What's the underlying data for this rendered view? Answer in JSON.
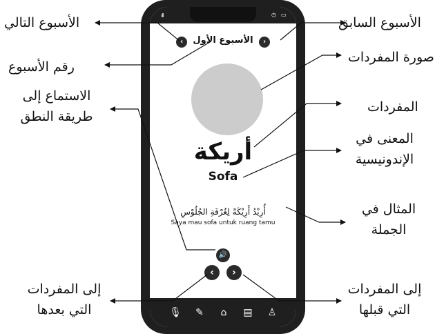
{
  "annotations": {
    "next_week": "الأسبوع التالي",
    "previous_week": "الأسبوع السابق",
    "week_number": "رقم الأسبوع",
    "vocab_picture": "صورة المفردات",
    "listen_line1": "الاستماع إلى",
    "listen_line2": "طريقة النطق",
    "vocabulary": "المفردات",
    "meaning_line1": "المعنى في",
    "meaning_line2": "الإندونيسية",
    "example_line1": "المثال في",
    "example_line2": "الجملة",
    "to_next_line1": "إلى المفردات",
    "to_next_line2": "التي بعدها",
    "to_prev_line1": "إلى المفردات",
    "to_prev_line2": "التي قبلها"
  },
  "phone": {
    "signal": "ıll",
    "week_title": "الأسبوع الأول",
    "prev_week_symbol": "‹",
    "next_week_symbol": "›",
    "vocab_word": "أريكة",
    "meaning": "Sofa",
    "example_arabic": "أُرِيْدُ أَرِيْكَةً لِغُرْفَةِ الجُلُوْسِ",
    "example_indonesian": "Saya mau sofa untuk ruang tamu",
    "speaker_symbol": "🔊",
    "prev_symbol": "‹",
    "next_symbol": "›",
    "tabs": [
      "🎙",
      "✎",
      "⌂",
      "▤",
      "♙"
    ]
  },
  "icons": [
    "signal-icon",
    "alarm-icon",
    "battery-icon",
    "speaker-icon",
    "microphone-icon",
    "edit-icon",
    "home-icon",
    "document-icon",
    "profile-icon"
  ]
}
